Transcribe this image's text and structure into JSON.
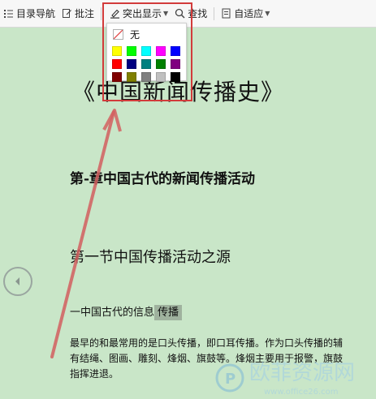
{
  "toolbar": {
    "toc_label": "目录导航",
    "annotate_label": "批注",
    "highlight_label": "突出显示",
    "find_label": "查找",
    "fit_label": "自适应"
  },
  "highlight_menu": {
    "none_label": "无",
    "swatches": [
      "#ffff00",
      "#00ff00",
      "#00ffff",
      "#ff00ff",
      "#0000ff",
      "#ff0000",
      "#000080",
      "#008080",
      "#008000",
      "#800080",
      "#800000",
      "#808000",
      "#808080",
      "#c0c0c0",
      "#000000"
    ]
  },
  "document": {
    "title": "《中国新闻传播史》",
    "chapter": "第-章中国古代的新闻传播活动",
    "section": "第一节中国传播活动之源",
    "subsection_prefix": "一中国古代的信息",
    "subsection_highlight": "传播",
    "para_line1": "最早的和最常用的是口头传播，即口耳传播。作为口头传播的辅",
    "para_line2": "有结绳、图画、雕刻、烽烟、旗鼓等。烽烟主要用于报警，旗鼓",
    "para_line3": "指挥进退。"
  },
  "watermark": {
    "text": "欧菲资源网",
    "url": "www.office26.com"
  },
  "colors": {
    "page_bg": "#c9e6c8",
    "toolbar_bg": "#f7f7f7",
    "annotation_red": "#d23b3b",
    "text_highlight": "#9fb29e"
  }
}
